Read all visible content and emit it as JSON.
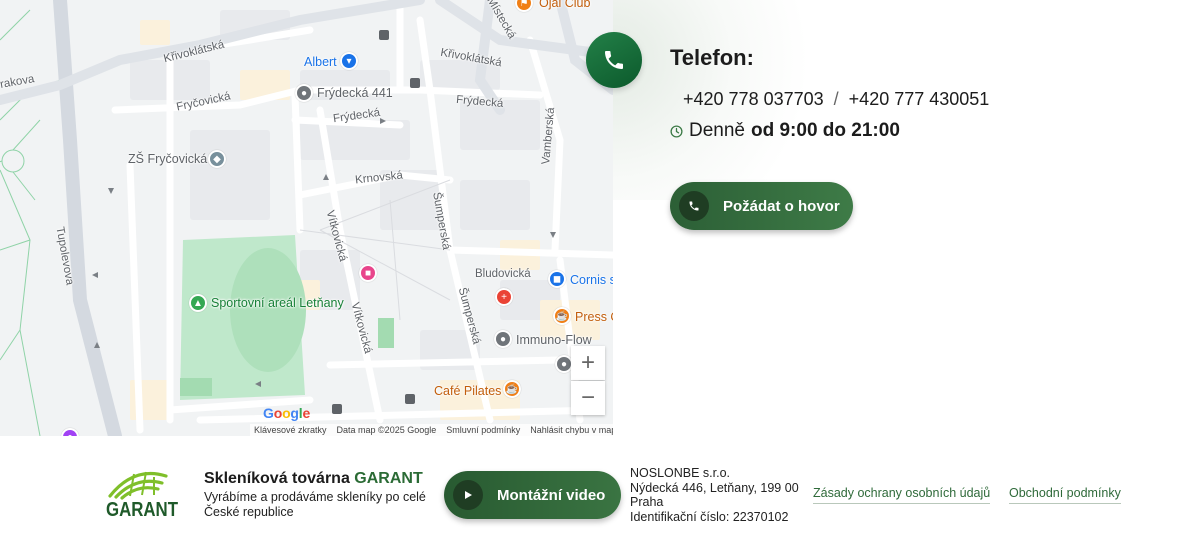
{
  "map": {
    "streets": {
      "krivoklatska_1": "Křivoklátská",
      "krivoklatska_2": "Křivoklátská",
      "rakova": "rakova",
      "frycovicka": "Fryčovická",
      "frydecka_1": "Frýdecká",
      "frydecka_2": "Frýdecká",
      "krnovska": "Krnovská",
      "tupolevova": "Tupolevova",
      "vitkovicka_1": "Vítkovická",
      "vitkovicka_2": "Vítkovická",
      "sumperska_1": "Šumperská",
      "sumperska_2": "Šumperská",
      "vamberska": "Vamberská",
      "bludovicka": "Bludovická",
      "mistecka": "Místecká"
    },
    "pois": {
      "ojai": "Ojai Club",
      "albert": "Albert",
      "frydecka441": "Frýdecká 441",
      "zs": "ZŠ Fryčovická",
      "sport": "Sportovní areál Letňany",
      "cornis": "Cornis s",
      "press": "Press C",
      "immuno": "Immuno-Flow",
      "cafe": "Café Pilates"
    },
    "google_logo": "Google",
    "zoom_in": "+",
    "zoom_out": "−",
    "footer": {
      "shortcuts": "Klávesové zkratky",
      "data": "Data map ©2025 Google",
      "terms": "Smluvní podmínky",
      "report": "Nahlásit chybu v mapě"
    }
  },
  "contact": {
    "title": "Telefon:",
    "phone1": "+420 778 037703",
    "separator": "/",
    "phone2": "+420 777 430051",
    "hours_prefix": "Denně",
    "hours_value": "od 9:00 do 21:00",
    "callback_label": "Požádat o hovor"
  },
  "footer": {
    "logo_text": "GARANT",
    "brand_prefix": "Skleníková továrna",
    "brand_highlight": "GARANT",
    "brand_subtitle": "Vyrábíme a prodáváme skleníky po celé České republice",
    "video_label": "Montážní video",
    "company_name": "NOSLONBE s.r.o.",
    "company_address": "Nýdecká 446, Letňany, 199 00 Praha",
    "company_id": "Identifikační číslo: 22370102",
    "link_privacy": "Zásady ochrany osobních údajů",
    "link_terms": "Obchodní podmínky"
  },
  "colors": {
    "accent_green": "#2b6b35",
    "phone_circle": "#1a7040",
    "button_green": "#3a7442",
    "map_park": "#bfe8cb"
  },
  "icons": {
    "phone": "phone-icon",
    "clock": "clock-icon",
    "play": "play-icon"
  }
}
